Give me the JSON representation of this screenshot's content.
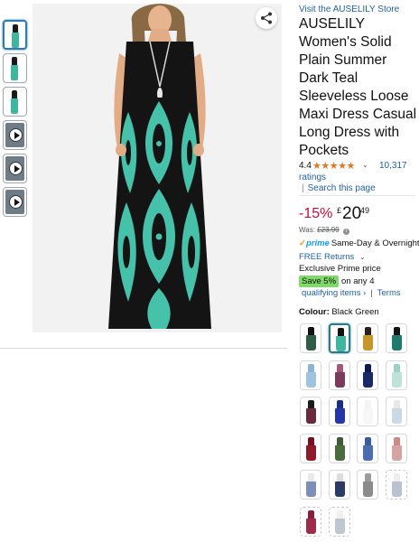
{
  "store_link": "Visit the AUSELILY Store",
  "title": "AUSELILY Women's Solid Plain Summer Dark Teal Sleeveless Loose Maxi Dress Casual Long Dress with Pockets",
  "rating": {
    "value": "4.4",
    "stars": "★★★★★",
    "star_fraction": 0.88,
    "count": "10,317",
    "count_word": "ratings",
    "search_link": "Search this page"
  },
  "price": {
    "discount": "-15%",
    "currency": "£",
    "whole": "20",
    "fraction": "49",
    "was_label": "Was:",
    "was_value": "£23.99"
  },
  "delivery": {
    "prime_check": "✓",
    "prime_word": "prime",
    "prime_text": "Same-Day & Overnight",
    "free_returns": "FREE Returns",
    "exclusive": "Exclusive Prime price"
  },
  "promo": {
    "save_badge": "Save 5%",
    "save_text": "on any 4",
    "qualifying_link": "qualifying items ›",
    "terms_link": "Terms"
  },
  "colour": {
    "label": "Colour:",
    "value": "Black Green"
  },
  "thumbnails": [
    {
      "kind": "image",
      "selected": true
    },
    {
      "kind": "image",
      "selected": false
    },
    {
      "kind": "image",
      "selected": false
    },
    {
      "kind": "video",
      "selected": false
    },
    {
      "kind": "video",
      "selected": false
    },
    {
      "kind": "video",
      "selected": false
    }
  ],
  "swatches": [
    {
      "top": "#111111",
      "skirt": "#2f5d45",
      "selected": false,
      "available": true
    },
    {
      "top": "#111111",
      "skirt": "#3fb7a0",
      "selected": true,
      "available": true
    },
    {
      "top": "#2a2017",
      "skirt": "#c8952b",
      "selected": false,
      "available": true
    },
    {
      "top": "#111111",
      "skirt": "#1d7a6c",
      "selected": false,
      "available": true
    },
    {
      "top": "#8ab4d8",
      "skirt": "#9fc4e0",
      "selected": false,
      "available": true
    },
    {
      "top": "#a4577a",
      "skirt": "#7c3b5d",
      "selected": false,
      "available": true
    },
    {
      "top": "#0f1c4a",
      "skirt": "#1b2a66",
      "selected": false,
      "available": true
    },
    {
      "top": "#9ad2c4",
      "skirt": "#bde3d8",
      "selected": false,
      "available": true
    },
    {
      "top": "#1a1a1a",
      "skirt": "#6a2b3c",
      "selected": false,
      "available": true
    },
    {
      "top": "#1c2a8a",
      "skirt": "#2436a8",
      "selected": false,
      "available": true
    },
    {
      "top": "#f4f4f4",
      "skirt": "#f7f7f7",
      "selected": false,
      "available": true
    },
    {
      "top": "#e8e8e8",
      "skirt": "#c9d9e6",
      "selected": false,
      "available": true
    },
    {
      "top": "#7a0f1f",
      "skirt": "#8e1a2a",
      "selected": false,
      "available": true
    },
    {
      "top": "#3f5a36",
      "skirt": "#4a6b3e",
      "selected": false,
      "available": true
    },
    {
      "top": "#3a5c9a",
      "skirt": "#4d6db0",
      "selected": false,
      "available": true
    },
    {
      "top": "#c98a8a",
      "skirt": "#d6a3a0",
      "selected": false,
      "available": true
    },
    {
      "top": "#e8e8e8",
      "skirt": "#7c8fb8",
      "selected": false,
      "available": true
    },
    {
      "top": "#dcdcdc",
      "skirt": "#2b3b66",
      "selected": false,
      "available": true
    },
    {
      "top": "#9c9c9c",
      "skirt": "#8b8b8b",
      "selected": false,
      "available": true
    },
    {
      "top": "#eeeeee",
      "skirt": "#b9c3cd",
      "selected": false,
      "available": false
    },
    {
      "top": "#8a1c3c",
      "skirt": "#a02a4a",
      "selected": false,
      "available": false
    },
    {
      "top": "#f0f0f0",
      "skirt": "#bcc7cf",
      "selected": false,
      "available": false
    }
  ]
}
